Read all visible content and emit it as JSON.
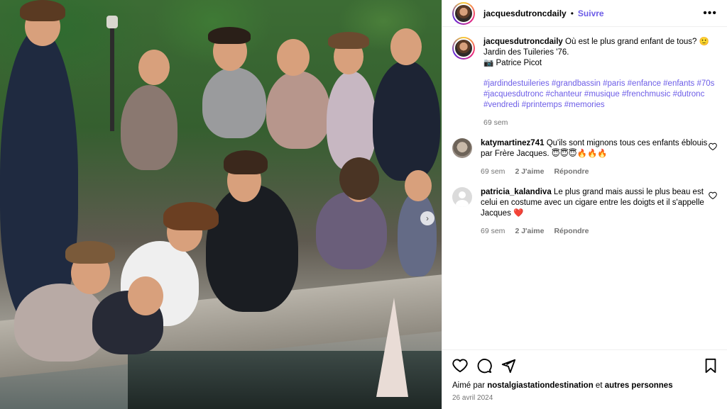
{
  "post": {
    "username": "jacquesdutroncdaily",
    "separator": "•",
    "follow_label": "Suivre",
    "more_label": "•••"
  },
  "caption": {
    "username": "jacquesdutroncdaily",
    "text_line1": " Où est le plus grand enfant de tous? 🙂",
    "text_line2": "Jardin des Tuileries '76.",
    "text_line3": "📷 Patrice Picot",
    "hashtags": "#jardindestuileries #grandbassin #paris #enfance #enfants #70s #jacquesdutronc #chanteur #musique #frenchmusic #dutronc #vendredi #printemps #memories",
    "time": "69 sem"
  },
  "comments": [
    {
      "username": "katymartinez741",
      "text": " Qu'ils sont mignons tous ces enfants éblouis par Frère Jacques. 😇😇😇🔥🔥🔥",
      "time": "69 sem",
      "likes": "2 J'aime",
      "reply": "Répondre"
    },
    {
      "username": "patricia_kalandiva",
      "text": " Le plus grand mais aussi le plus beau est celui en costume avec un cigare entre les doigts et il s'appelle Jacques ❤️",
      "time": "69 sem",
      "likes": "2 J'aime",
      "reply": "Répondre"
    }
  ],
  "footer": {
    "liked_prefix": "Aimé par ",
    "liked_user": "nostalgiastationdestination",
    "liked_middle": " et ",
    "liked_others": "autres personnes",
    "date": "26 avril 2024"
  },
  "icons": {
    "like": "heart-icon",
    "comment": "comment-icon",
    "share": "share-icon",
    "save": "bookmark-icon",
    "next": "chevron-right-icon"
  },
  "colors": {
    "accent": "#6c5ce7",
    "muted": "#737373",
    "border": "#efefef"
  }
}
